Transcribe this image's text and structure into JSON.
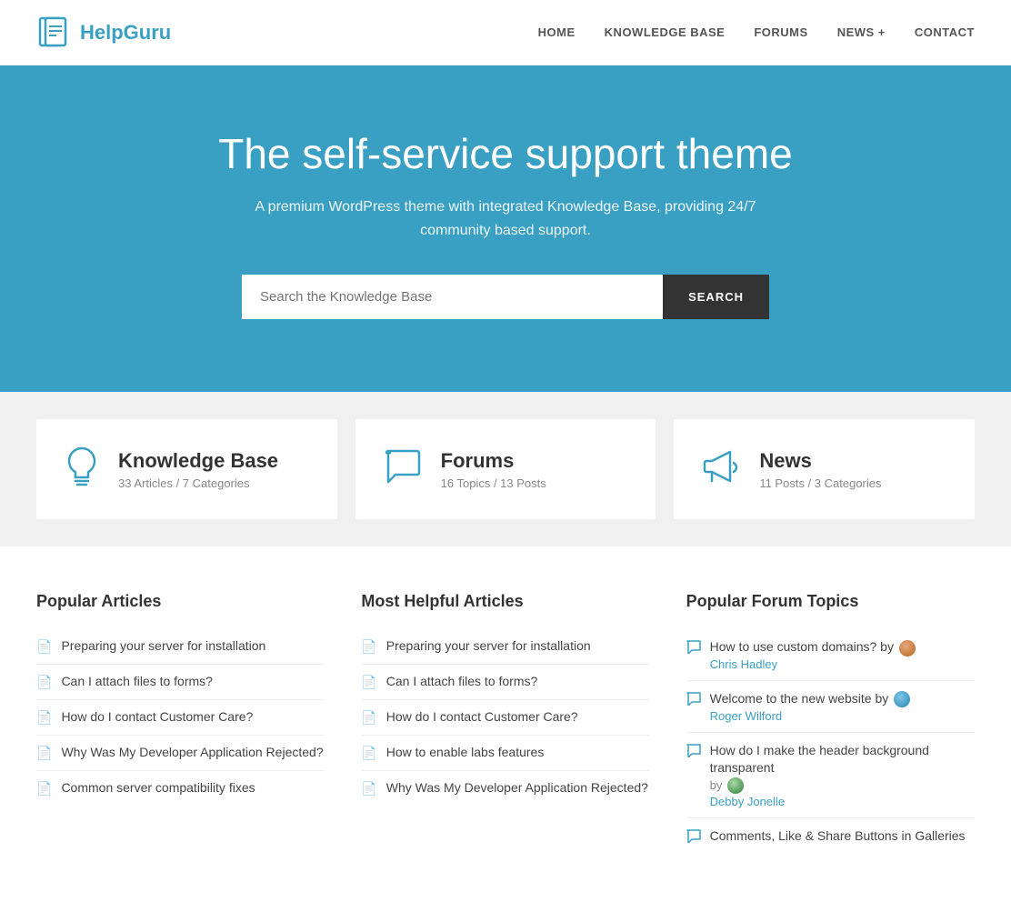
{
  "header": {
    "logo_text": "HelpGuru",
    "nav": [
      {
        "label": "HOME",
        "id": "home"
      },
      {
        "label": "KNOWLEDGE BASE",
        "id": "knowledge-base"
      },
      {
        "label": "FORUMS",
        "id": "forums"
      },
      {
        "label": "NEWS +",
        "id": "news"
      },
      {
        "label": "CONTACT",
        "id": "contact"
      }
    ]
  },
  "hero": {
    "title": "The self-service support theme",
    "subtitle": "A premium WordPress theme with integrated Knowledge Base, providing 24/7 community based support.",
    "search_placeholder": "Search the Knowledge Base",
    "search_button": "SEARCH"
  },
  "stats": [
    {
      "id": "kb",
      "title": "Knowledge Base",
      "sub": "33 Articles / 7 Categories",
      "icon": "lightbulb"
    },
    {
      "id": "forums",
      "title": "Forums",
      "sub": "16 Topics / 13 Posts",
      "icon": "chat"
    },
    {
      "id": "news",
      "title": "News",
      "sub": "11 Posts / 3 Categories",
      "icon": "megaphone"
    }
  ],
  "popular_articles": {
    "section_title": "Popular Articles",
    "items": [
      "Preparing your server for installation",
      "Can I attach files to forms?",
      "How do I contact Customer Care?",
      "Why Was My Developer Application Rejected?",
      "Common server compatibility fixes"
    ]
  },
  "helpful_articles": {
    "section_title": "Most Helpful Articles",
    "items": [
      "Preparing your server for installation",
      "Can I attach files to forms?",
      "How do I contact Customer Care?",
      "How to enable labs features",
      "Why Was My Developer Application Rejected?"
    ]
  },
  "forum_topics": {
    "section_title": "Popular Forum Topics",
    "items": [
      {
        "text": "How to use custom domains? by",
        "author": "Chris Hadley",
        "avatar": "1"
      },
      {
        "text": "Welcome to the new website by",
        "author": "Roger Wilford",
        "avatar": "2"
      },
      {
        "text": "How do I make the header background transparent",
        "by_label": "by",
        "author": "Debby Jonelle",
        "avatar": "3"
      },
      {
        "text": "Comments, Like & Share Buttons in Galleries",
        "author": "",
        "avatar": ""
      }
    ]
  }
}
